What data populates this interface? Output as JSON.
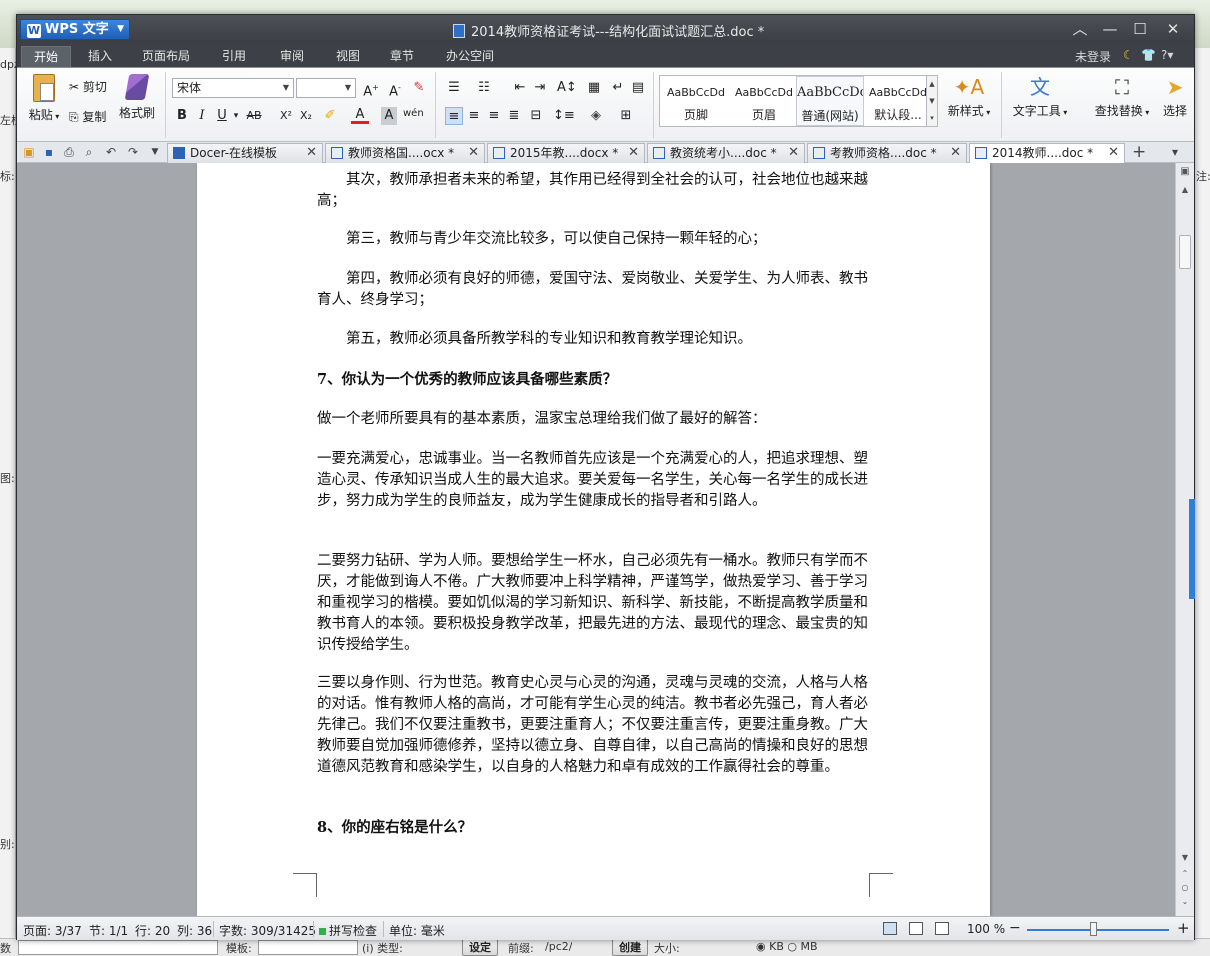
{
  "app": {
    "logo_label": "WPS 文字",
    "doc_title": "2014教师资格证考试---结构化面试试题汇总.doc *"
  },
  "menu": {
    "items": [
      "开始",
      "插入",
      "页面布局",
      "引用",
      "审阅",
      "视图",
      "章节",
      "办公空间"
    ],
    "active": "开始",
    "login": "未登录"
  },
  "ribbon": {
    "paste": "粘贴",
    "cut": "剪切",
    "copy": "复制",
    "format_painter": "格式刷",
    "font_name": "宋体",
    "font_size": "",
    "styles": [
      {
        "sample": "AaBbCcDd",
        "name": "页脚"
      },
      {
        "sample": "AaBbCcDd",
        "name": "页眉"
      },
      {
        "sample": "AaBbCcDc",
        "name": "普通(网站)"
      },
      {
        "sample": "AaBbCcDd",
        "name": "默认段..."
      }
    ],
    "new_style": "新样式",
    "text_tools": "文字工具",
    "find_replace": "查找替换",
    "select": "选择"
  },
  "tabs": [
    {
      "label": "Docer-在线模板",
      "active": false
    },
    {
      "label": "教师资格国....ocx *",
      "active": false
    },
    {
      "label": "2015年教....docx *",
      "active": false
    },
    {
      "label": "教资统考小....doc *",
      "active": false
    },
    {
      "label": "考教师资格....doc *",
      "active": false
    },
    {
      "label": "2014教师....doc *",
      "active": true
    }
  ],
  "document": {
    "paragraphs": [
      "　　其次，教师承担者未来的希望，其作用已经得到全社会的认可，社会地位也越来越高；",
      "　　第三，教师与青少年交流比较多，可以使自己保持一颗年轻的心；",
      "　　第四，教师必须有良好的师德，爱国守法、爱岗敬业、关爱学生、为人师表、教书育人、终身学习；",
      "　　第五，教师必须具备所教学科的专业知识和教育教学理论知识。",
      "7、你认为一个优秀的教师应该具备哪些素质？",
      "做一个老师所要具有的基本素质，温家宝总理给我们做了最好的解答：",
      "一要充满爱心，忠诚事业。当一名教师首先应该是一个充满爱心的人，把追求理想、塑造心灵、传承知识当成人生的最大追求。要关爱每一名学生，关心每一名学生的成长进步，努力成为学生的良师益友，成为学生健康成长的指导者和引路人。",
      "二要努力钻研、学为人师。要想给学生一杯水，自己必须先有一桶水。教师只有学而不厌，才能做到诲人不倦。广大教师要冲上科学精神，严谨笃学，做热爱学习、善于学习和重视学习的楷模。要如饥似渴的学习新知识、新科学、新技能，不断提高教学质量和教书育人的本领。要积极投身教学改革，把最先进的方法、最现代的理念、最宝贵的知识传授给学生。",
      "三要以身作则、行为世范。教育史心灵与心灵的沟通，灵魂与灵魂的交流，人格与人格的对话。惟有教师人格的高尚，才可能有学生心灵的纯洁。教书者必先强己，育人者必先律己。我们不仅要注重教书，更要注重育人；不仅要注重言传，更要注重身教。广大教师要自觉加强师德修养，坚持以德立身、自尊自律，以自己高尚的情操和良好的思想道德风范教育和感染学生，以自身的人格魅力和卓有成效的工作赢得社会的尊重。",
      "8、你的座右铭是什么？"
    ]
  },
  "status": {
    "page": "页面: 3/37",
    "section": "节: 1/1",
    "row": "行: 20",
    "col": "列: 36",
    "words": "字数: 309/31425",
    "spell": "拼写检查",
    "unit": "单位: 毫米",
    "zoom": "100 %"
  },
  "background": {
    "left_fragments": [
      "dpz",
      "左栏",
      "标:",
      "图:",
      "别:",
      "数"
    ],
    "right_fragments": [
      "注:"
    ],
    "bottom_fragments": [
      "模板:",
      "(i) 类型:",
      "设定",
      "前缀:",
      "/pc2/",
      "创建",
      "大小:",
      "KB",
      "MB"
    ]
  },
  "colors": {
    "accent": "#2d7fd8",
    "titlebar": "#3d4046",
    "page": "#ffffff"
  }
}
